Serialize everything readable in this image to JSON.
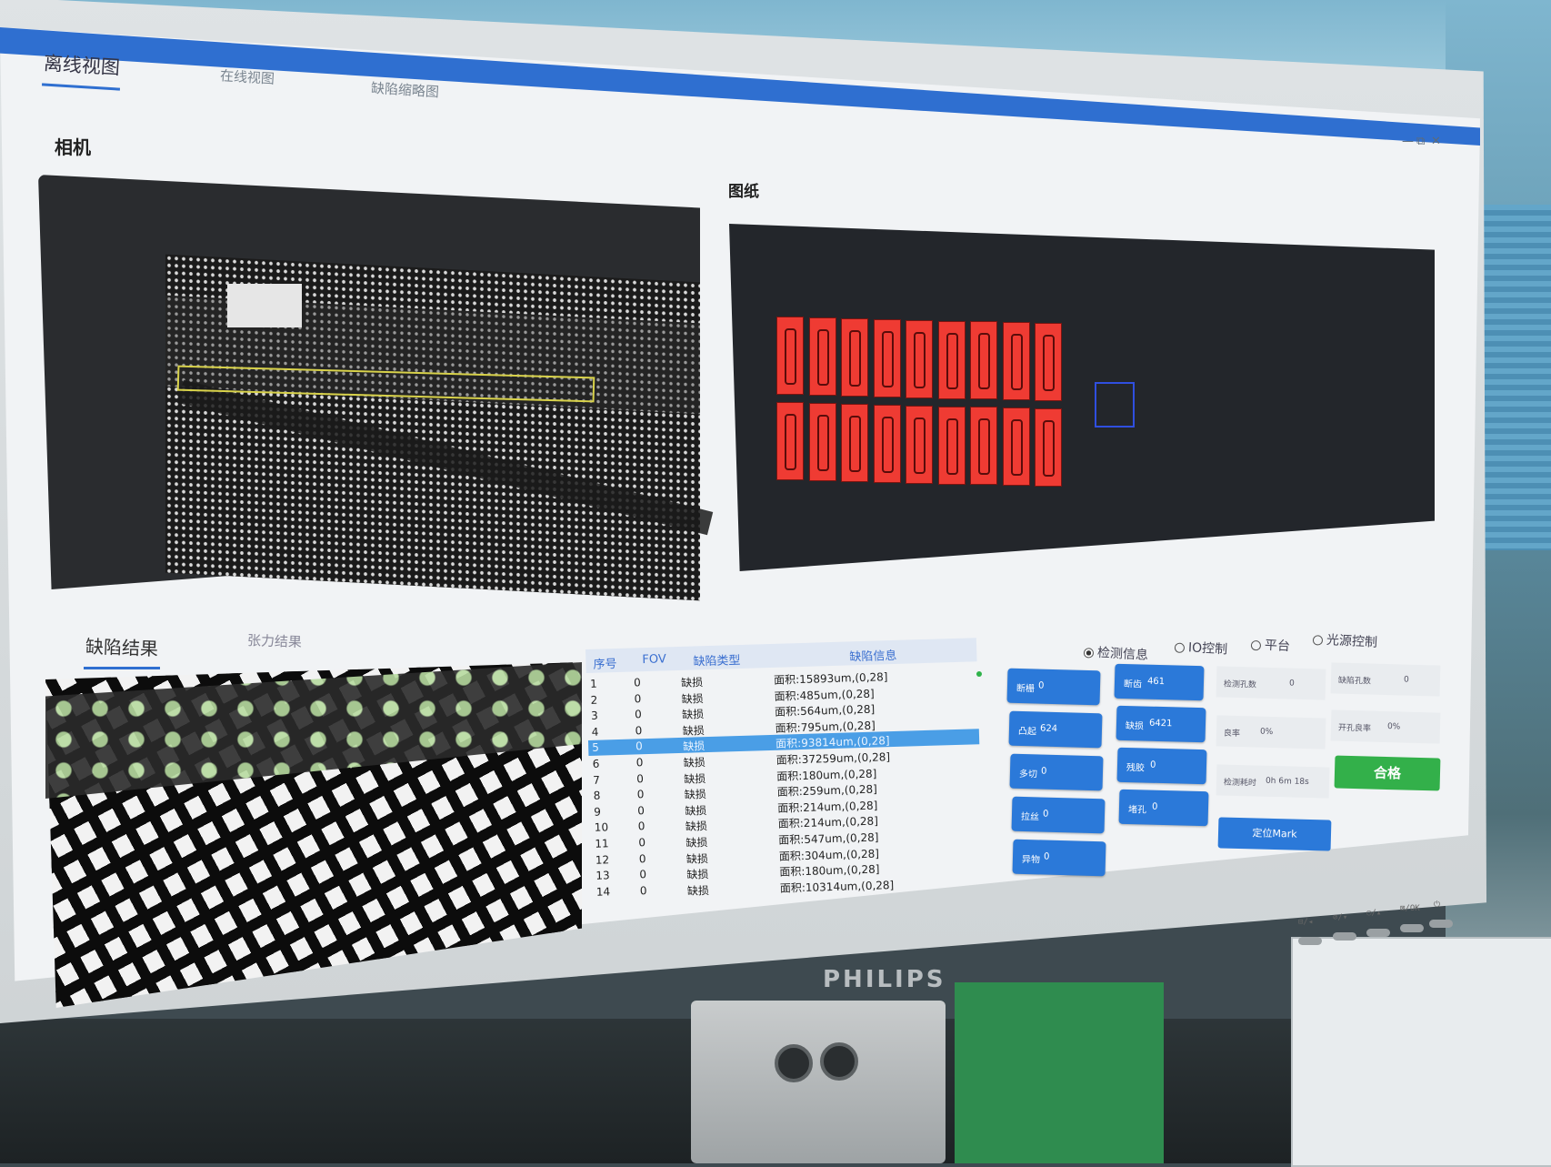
{
  "nav": {
    "tabs": [
      {
        "label": "离线视图",
        "active": true
      },
      {
        "label": "在线视图",
        "active": false
      },
      {
        "label": "缺陷缩略图",
        "active": false
      }
    ]
  },
  "window_controls": {
    "minimize": "—",
    "restore": "⧉",
    "close": "✕"
  },
  "camera": {
    "title": "相机"
  },
  "drawing": {
    "title": "图纸"
  },
  "bottom_tabs": [
    {
      "label": "缺陷结果",
      "active": true
    },
    {
      "label": "张力结果",
      "active": false
    }
  ],
  "defect_table": {
    "headers": [
      "序号",
      "FOV",
      "缺陷类型",
      "缺陷信息"
    ],
    "rows": [
      {
        "idx": "1",
        "fov": "0",
        "type": "缺损",
        "info": "面积:15893um,(0,28]"
      },
      {
        "idx": "2",
        "fov": "0",
        "type": "缺损",
        "info": "面积:485um,(0,28]"
      },
      {
        "idx": "3",
        "fov": "0",
        "type": "缺损",
        "info": "面积:564um,(0,28]"
      },
      {
        "idx": "4",
        "fov": "0",
        "type": "缺损",
        "info": "面积:795um,(0,28]"
      },
      {
        "idx": "5",
        "fov": "0",
        "type": "缺损",
        "info": "面积:93814um,(0,28]",
        "selected": true
      },
      {
        "idx": "6",
        "fov": "0",
        "type": "缺损",
        "info": "面积:37259um,(0,28]"
      },
      {
        "idx": "7",
        "fov": "0",
        "type": "缺损",
        "info": "面积:180um,(0,28]"
      },
      {
        "idx": "8",
        "fov": "0",
        "type": "缺损",
        "info": "面积:259um,(0,28]"
      },
      {
        "idx": "9",
        "fov": "0",
        "type": "缺损",
        "info": "面积:214um,(0,28]"
      },
      {
        "idx": "10",
        "fov": "0",
        "type": "缺损",
        "info": "面积:214um,(0,28]"
      },
      {
        "idx": "11",
        "fov": "0",
        "type": "缺损",
        "info": "面积:547um,(0,28]"
      },
      {
        "idx": "12",
        "fov": "0",
        "type": "缺损",
        "info": "面积:304um,(0,28]"
      },
      {
        "idx": "13",
        "fov": "0",
        "type": "缺损",
        "info": "面积:180um,(0,28]"
      },
      {
        "idx": "14",
        "fov": "0",
        "type": "缺损",
        "info": "面积:10314um,(0,28]"
      }
    ]
  },
  "panel_options": [
    {
      "label": "检测信息",
      "checked": true
    },
    {
      "label": "IO控制",
      "checked": false
    },
    {
      "label": "平台",
      "checked": false
    },
    {
      "label": "光源控制",
      "checked": false
    }
  ],
  "stats_left": [
    {
      "label": "断栅",
      "value": "0"
    },
    {
      "label": "凸起",
      "value": "624"
    },
    {
      "label": "多切",
      "value": "0"
    },
    {
      "label": "拉丝",
      "value": "0"
    },
    {
      "label": "异物",
      "value": "0"
    }
  ],
  "stats_right": [
    {
      "label": "断齿",
      "value": "461"
    },
    {
      "label": "缺损",
      "value": "6421"
    },
    {
      "label": "残胶",
      "value": "0"
    },
    {
      "label": "堵孔",
      "value": "0"
    }
  ],
  "info": {
    "holes": {
      "label": "检测孔数",
      "value": "0"
    },
    "defect_holes": {
      "label": "缺陷孔数",
      "value": "0"
    },
    "yield": {
      "label": "良率",
      "value": "0%"
    },
    "open_rate": {
      "label": "开孔良率",
      "value": "0%"
    },
    "time": {
      "label": "检测耗时",
      "value": "0h 6m 18s"
    }
  },
  "buttons": {
    "pass": "合格",
    "locate_mark": "定位Mark"
  },
  "monitor": {
    "brand": "PHILIPS",
    "keys": [
      "⊟/◂",
      "⊘/▾",
      "○/▴",
      "⊠/OK",
      "⏻"
    ]
  },
  "colors": {
    "accent": "#2f6fd0",
    "button_blue": "#2b79d9",
    "pass_green": "#33b04a",
    "pad_red": "#ef3b33"
  }
}
